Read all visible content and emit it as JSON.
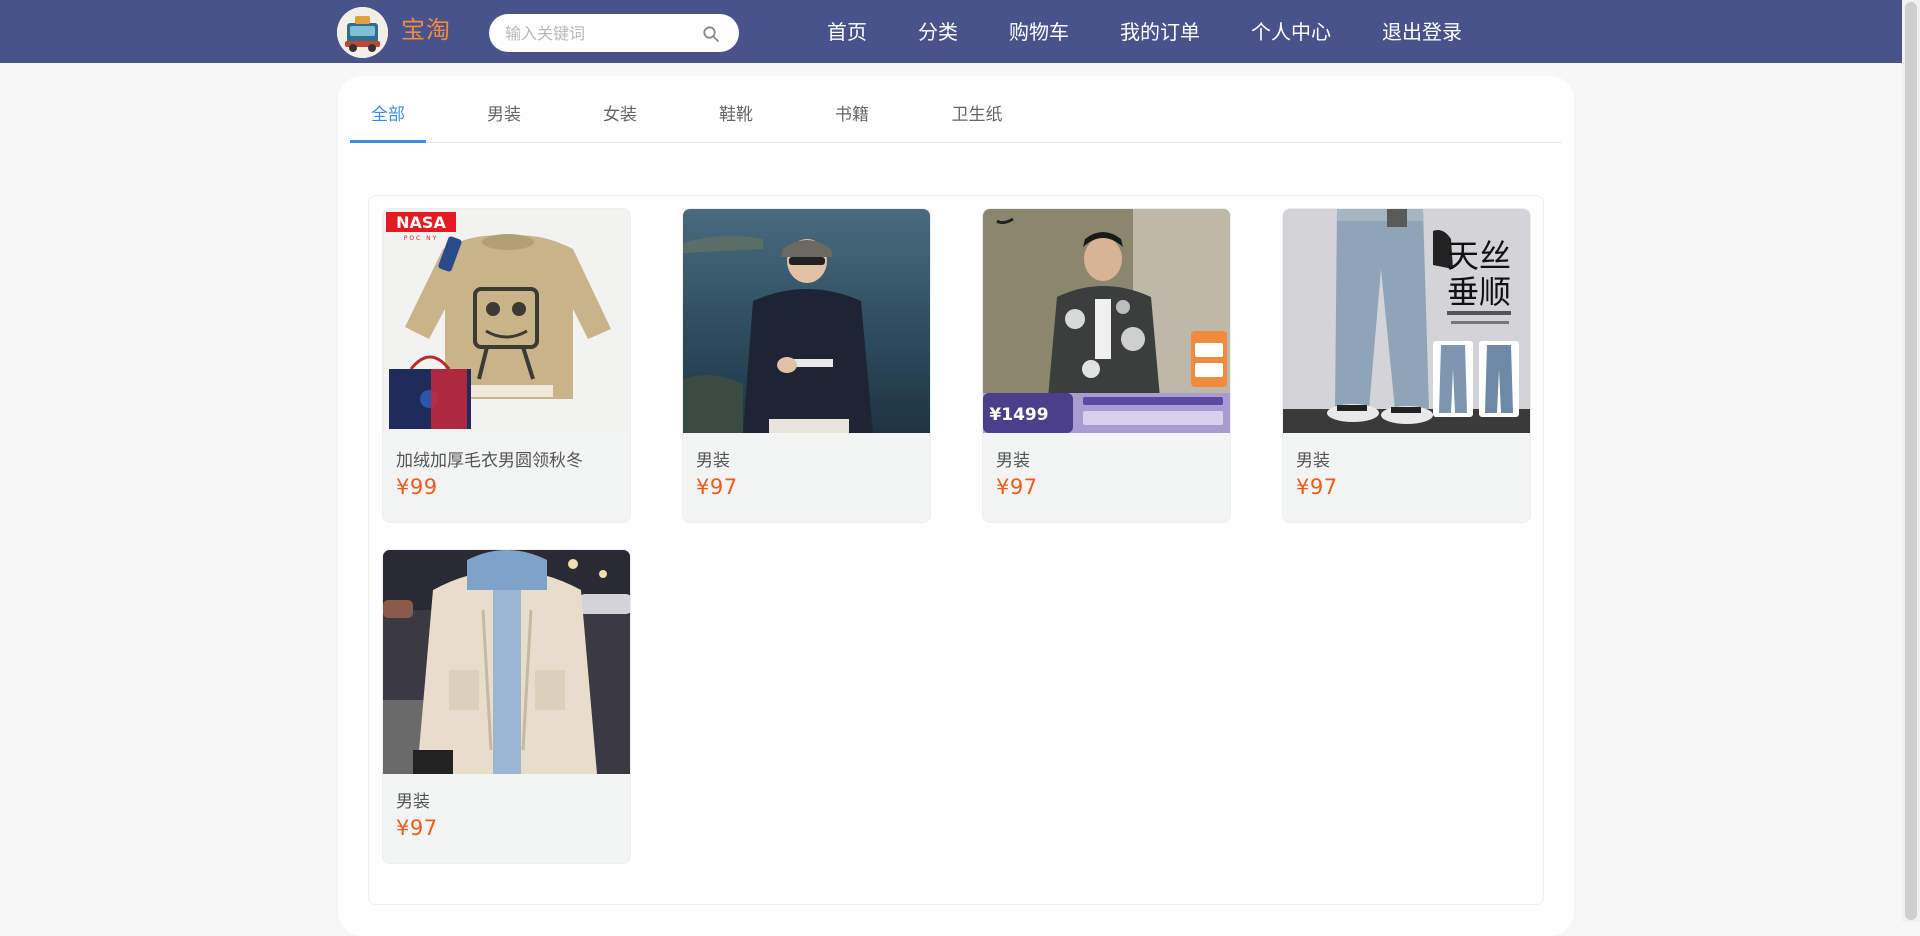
{
  "header": {
    "brand": "宝淘",
    "search": {
      "placeholder": "输入关键词",
      "value": ""
    },
    "nav": [
      {
        "label": "首页"
      },
      {
        "label": "分类"
      },
      {
        "label": "购物车"
      },
      {
        "label": "我的订单"
      },
      {
        "label": "个人中心"
      },
      {
        "label": "退出登录"
      }
    ]
  },
  "tabs": [
    {
      "label": "全部",
      "active": true
    },
    {
      "label": "男装",
      "active": false
    },
    {
      "label": "女装",
      "active": false
    },
    {
      "label": "鞋靴",
      "active": false
    },
    {
      "label": "书籍",
      "active": false
    },
    {
      "label": "卫生纸",
      "active": false
    }
  ],
  "products": [
    {
      "name": "加绒加厚毛衣男圆领秋冬",
      "price": "¥99"
    },
    {
      "name": "男装",
      "price": "¥97"
    },
    {
      "name": "男装",
      "price": "¥97"
    },
    {
      "name": "男装",
      "price": "¥97"
    },
    {
      "name": "男装",
      "price": "¥97"
    }
  ],
  "product_image_text": {
    "nasa_logo": "NASA",
    "nasa_sub": "POC NY",
    "promo_price": "¥1499",
    "banner_title_1": "天丝",
    "banner_title_2": "垂顺"
  },
  "colors": {
    "header_bg": "#48538c",
    "brand": "#f08a3c",
    "active_tab": "#3a8ee6",
    "price": "#f05a1a"
  }
}
